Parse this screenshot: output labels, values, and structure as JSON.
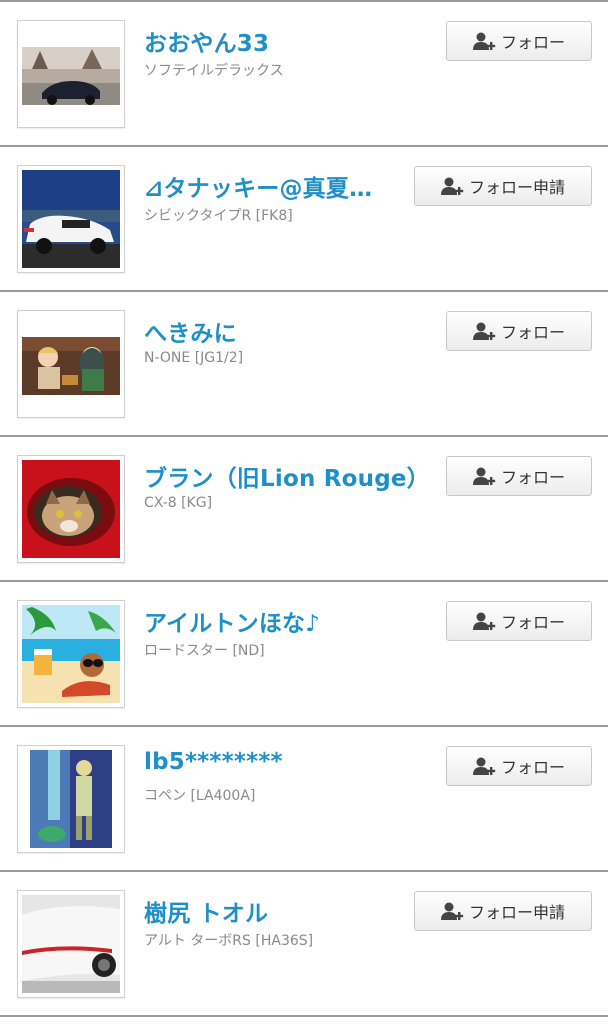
{
  "users": [
    {
      "name": "おおやん33",
      "car": "ソフテイルデラックス",
      "button": "フォロー",
      "button_type": "follow",
      "avatar_icon": "car-photo-icon"
    },
    {
      "name": "⊿タナッキー@真夏…",
      "car": "シビックタイプR [FK8]",
      "button": "フォロー申請",
      "button_type": "request",
      "avatar_icon": "car-photo-icon"
    },
    {
      "name": "へきみに",
      "car": "N-ONE [JG1/2]",
      "button": "フォロー",
      "button_type": "follow",
      "avatar_icon": "anime-illustration-icon"
    },
    {
      "name": "ブラン（旧Lion Rouge）",
      "car": "CX-8 [KG]",
      "button": "フォロー",
      "button_type": "follow",
      "avatar_icon": "cat-photo-icon"
    },
    {
      "name": "アイルトンほな♪",
      "car": "ロードスター [ND]",
      "button": "フォロー",
      "button_type": "follow",
      "avatar_icon": "beach-illustration-icon"
    },
    {
      "name": "lb5********",
      "car": "コペン [LA400A]",
      "button": "フォロー",
      "button_type": "follow",
      "avatar_icon": "figure-photo-icon"
    },
    {
      "name": "樹尻 トオル",
      "car": "アルト ターボRS [HA36S]",
      "button": "フォロー申請",
      "button_type": "request",
      "avatar_icon": "car-photo-icon"
    }
  ],
  "colors": {
    "name": "#1f8fc8",
    "subtext": "#8a8a8a",
    "divider": "#9a9a9a"
  }
}
